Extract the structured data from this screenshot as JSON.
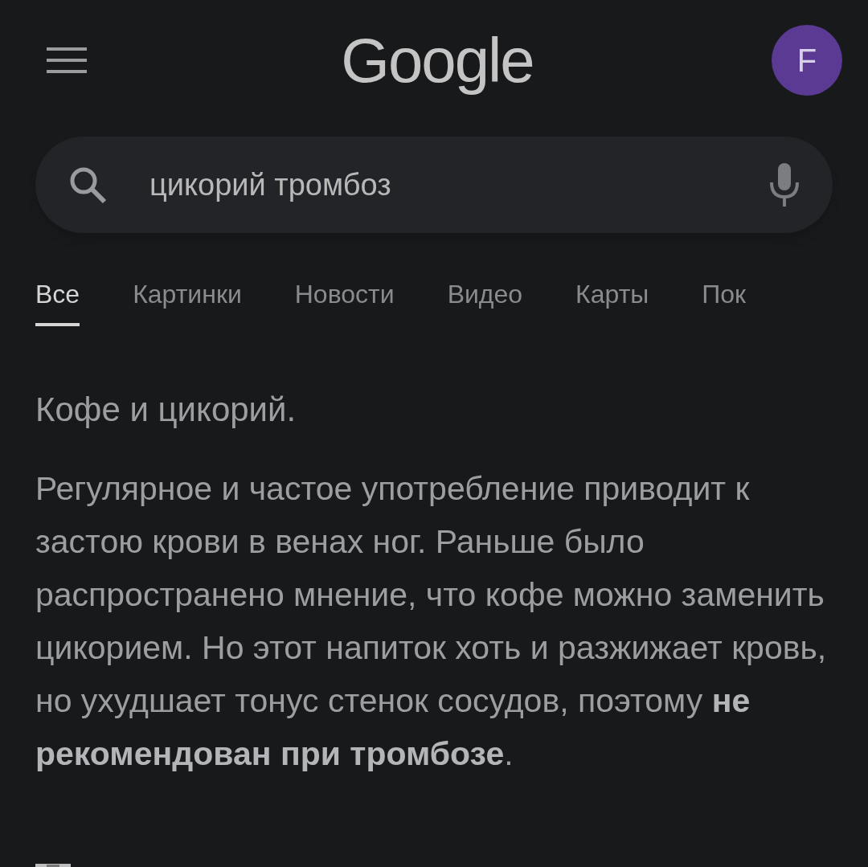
{
  "header": {
    "logo": "Google",
    "avatar": "F"
  },
  "search": {
    "value": "цикорий тромбоз"
  },
  "tabs": [
    {
      "label": "Все",
      "selected": true
    },
    {
      "label": "Картинки",
      "selected": false
    },
    {
      "label": "Новости",
      "selected": false
    },
    {
      "label": "Видео",
      "selected": false
    },
    {
      "label": "Карты",
      "selected": false
    },
    {
      "label": "Пок",
      "selected": false
    }
  ],
  "result": {
    "title": "Кофе и цикорий.",
    "snippet": "Регулярное и частое употребление приводит к застою крови в венах ног. Раньше было распространено мнение, что кофе можно заменить цикорием. Но этот напиток хоть и разжижает кровь, но ухудшает тонус стенок сосудов, поэтому **не рекомендован при тромбозе**."
  }
}
